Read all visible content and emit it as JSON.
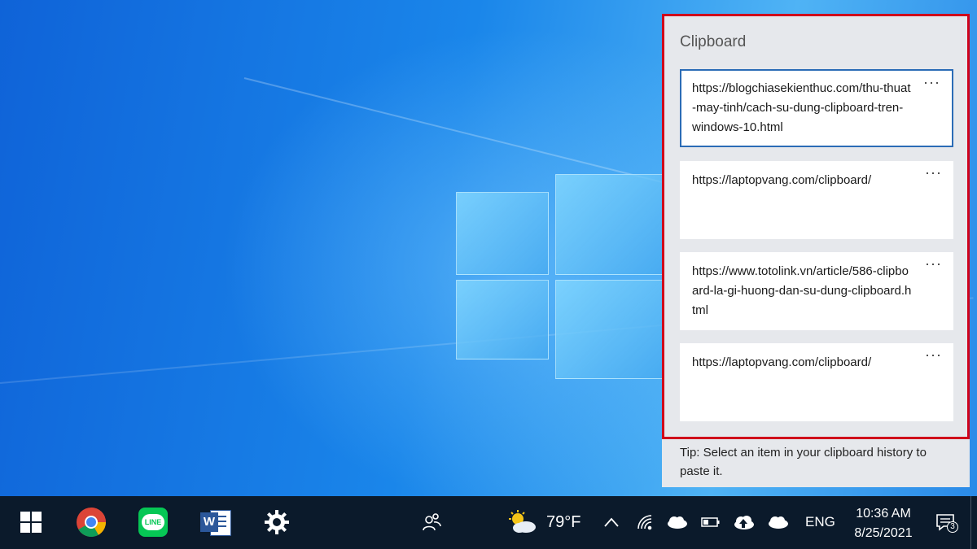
{
  "clipboard": {
    "title": "Clipboard",
    "items": [
      {
        "text": "https://blogchiasekienthuc.com/thu-thuat-may-tinh/cach-su-dung-clipboard-tren-windows-10.html",
        "more": "···"
      },
      {
        "text": "https://laptopvang.com/clipboard/",
        "more": "···"
      },
      {
        "text": "https://www.totolink.vn/article/586-clipboard-la-gi-huong-dan-su-dung-clipboard.html",
        "more": "···"
      },
      {
        "text": "https://laptopvang.com/clipboard/",
        "more": "···"
      }
    ],
    "tip": "Tip: Select an item in your clipboard history to paste it."
  },
  "taskbar": {
    "apps": [
      "start-icon",
      "chrome-icon",
      "line-icon",
      "word-icon",
      "settings-icon"
    ],
    "line_label": "LINE",
    "word_label": "W",
    "weather_temp": "79°F",
    "language": "ENG",
    "time": "10:36 AM",
    "date": "8/25/2021",
    "notification_count": "3"
  },
  "colors": {
    "highlight_border": "#d0021b",
    "selected_item_border": "#2b6cb6",
    "taskbar_bg": "#0b1a2b"
  }
}
